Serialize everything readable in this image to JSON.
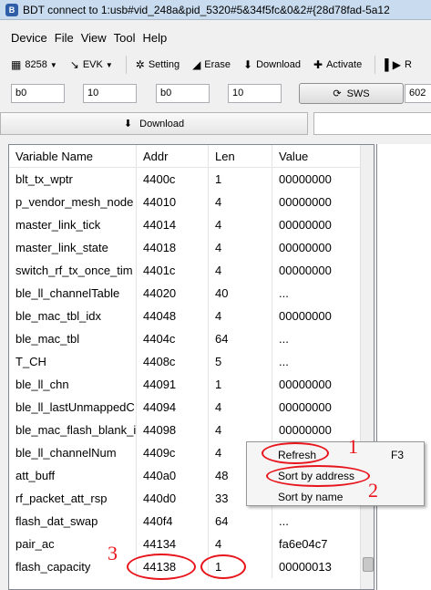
{
  "window": {
    "title": "BDT connect to 1:usb#vid_248a&pid_5320#5&34f5fc&0&2#{28d78fad-5a12"
  },
  "menu": [
    "Device",
    "File",
    "View",
    "Tool",
    "Help"
  ],
  "toolbar": {
    "chip": "8258",
    "board": "EVK",
    "setting": "Setting",
    "erase": "Erase",
    "download": "Download",
    "activate": "Activate",
    "cut": "R"
  },
  "fields": {
    "f1": "b0",
    "f2": "10",
    "f3": "b0",
    "f4": "10",
    "sws": "SWS",
    "f5": "602"
  },
  "download_label": "Download",
  "table": {
    "headers": [
      "Variable Name",
      "Addr",
      "Len",
      "Value"
    ],
    "rows": [
      [
        "blt_tx_wptr",
        "4400c",
        "1",
        "00000000"
      ],
      [
        "p_vendor_mesh_node",
        "44010",
        "4",
        "00000000"
      ],
      [
        "master_link_tick",
        "44014",
        "4",
        "00000000"
      ],
      [
        "master_link_state",
        "44018",
        "4",
        "00000000"
      ],
      [
        "switch_rf_tx_once_tim",
        "4401c",
        "4",
        "00000000"
      ],
      [
        "ble_ll_channelTable",
        "44020",
        "40",
        "..."
      ],
      [
        "ble_mac_tbl_idx",
        "44048",
        "4",
        "00000000"
      ],
      [
        "ble_mac_tbl",
        "4404c",
        "64",
        "..."
      ],
      [
        "T_CH",
        "4408c",
        "5",
        "..."
      ],
      [
        "ble_ll_chn",
        "44091",
        "1",
        "00000000"
      ],
      [
        "ble_ll_lastUnmappedC",
        "44094",
        "4",
        "00000000"
      ],
      [
        "ble_mac_flash_blank_i",
        "44098",
        "4",
        "00000000"
      ],
      [
        "ble_ll_channelNum",
        "4409c",
        "4",
        ""
      ],
      [
        "att_buff",
        "440a0",
        "48",
        ""
      ],
      [
        "rf_packet_att_rsp",
        "440d0",
        "33",
        ""
      ],
      [
        "flash_dat_swap",
        "440f4",
        "64",
        "..."
      ],
      [
        "pair_ac",
        "44134",
        "4",
        "fa6e04c7"
      ],
      [
        "flash_capacity",
        "44138",
        "1",
        "00000013"
      ]
    ]
  },
  "context_menu": {
    "refresh": "Refresh",
    "refresh_shortcut": "F3",
    "sort_address": "Sort by address",
    "sort_name": "Sort by name"
  },
  "annotations": {
    "n1": "1",
    "n2": "2",
    "n3": "3",
    "color": "#e8141c"
  }
}
